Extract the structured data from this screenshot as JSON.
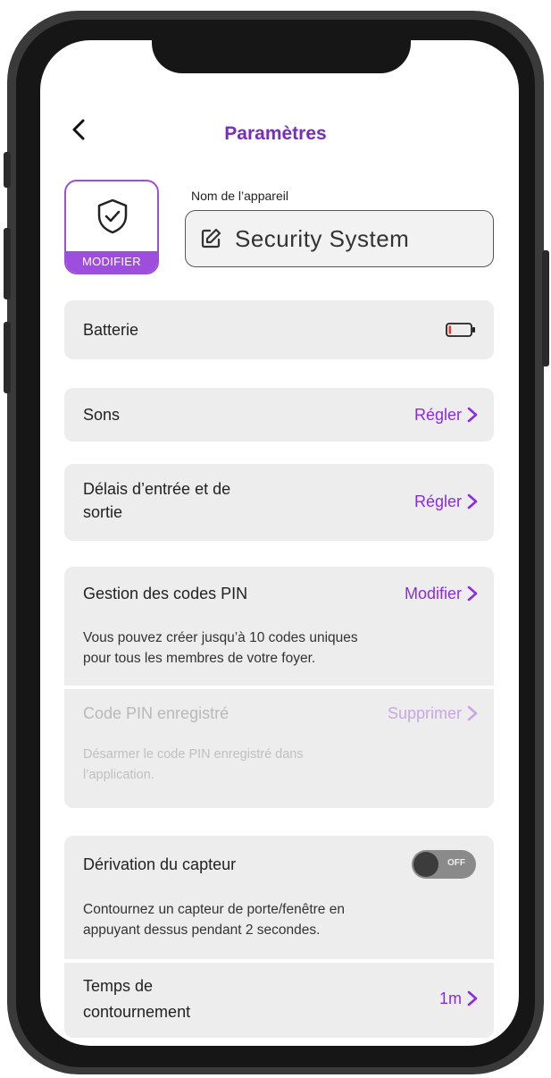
{
  "header": {
    "title": "Paramètres"
  },
  "device": {
    "modify_label": "MODIFIER",
    "name_label": "Nom de l’appareil",
    "name_value": "Security System"
  },
  "battery": {
    "label": "Batterie",
    "level_percent": 5
  },
  "sounds": {
    "label": "Sons",
    "action": "Régler"
  },
  "delays": {
    "label_line1": "Délais d’entrée et de",
    "label_line2": "sortie",
    "action": "Régler"
  },
  "pin_management": {
    "label": "Gestion des codes PIN",
    "action": "Modifier",
    "desc_line1": "Vous pouvez créer jusqu’à 10 codes uniques",
    "desc_line2": "pour tous les membres de votre foyer."
  },
  "saved_pin": {
    "label": "Code PIN enregistré",
    "action": "Supprimer",
    "desc_line1": "Désarmer le code PIN enregistré dans",
    "desc_line2": "l’application."
  },
  "sensor_bypass": {
    "label": "Dérivation du capteur",
    "toggle_state": "OFF",
    "desc_line1": "Contournez un capteur de porte/fenêtre en",
    "desc_line2": "appuyant dessus pendant 2 secondes."
  },
  "bypass_time": {
    "label_line1": "Temps de",
    "label_line2": "contournement",
    "value": "1m"
  },
  "colors": {
    "accent": "#8a2be2",
    "title": "#7b2cbf",
    "card_bg": "#ededed"
  }
}
